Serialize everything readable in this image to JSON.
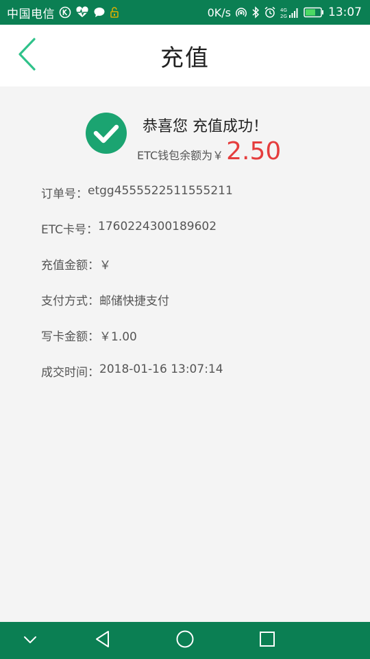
{
  "status_bar": {
    "carrier": "中国电信",
    "speed": "0K/s",
    "battery_level": "55",
    "time": "13:07",
    "icons": [
      "k-badge-icon",
      "heart-monitor-icon",
      "message-icon",
      "lock-icon",
      "hotspot-icon",
      "bluetooth-icon",
      "alarm-icon",
      "signal-4g-icon",
      "battery-icon"
    ]
  },
  "header": {
    "back_icon": "chevron-left-icon",
    "title": "充值"
  },
  "success": {
    "icon": "check-circle-icon",
    "title": "恭喜您 充值成功！",
    "balance_label": "ETC钱包余额为￥",
    "balance_value": "2.50"
  },
  "details": [
    {
      "label": "订单号：",
      "value": "etgg4555522511555211"
    },
    {
      "label": "ETC卡号：",
      "value": "1760224300189602"
    },
    {
      "label": "充值金额：",
      "value": "￥"
    },
    {
      "label": "支付方式：",
      "value": "邮储快捷支付"
    },
    {
      "label": "写卡金额：",
      "value": "￥1.00"
    },
    {
      "label": "成交时间：",
      "value": "2018-01-16 13:07:14"
    }
  ],
  "nav_bar": {
    "icons": [
      "chevron-down-icon",
      "back-triangle-icon",
      "home-circle-icon",
      "recents-square-icon"
    ]
  },
  "colors": {
    "brand_green": "#0b7f53",
    "success_green": "#1ba471",
    "back_arrow": "#2fc28a",
    "amount_red": "#e53d3d"
  }
}
